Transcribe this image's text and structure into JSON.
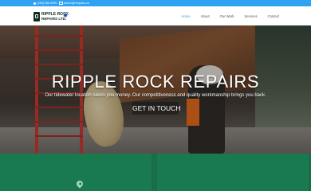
{
  "topbar": {
    "phone": "(250) 286-9999",
    "email": "admin@rrrepairs.ca"
  },
  "logo": {
    "line1": "RIPPLE ROCK",
    "line2": "REPAIRS LTD."
  },
  "nav": {
    "items": [
      {
        "label": "Home",
        "active": true
      },
      {
        "label": "About",
        "active": false
      },
      {
        "label": "Our Work",
        "active": false
      },
      {
        "label": "Services",
        "active": false
      },
      {
        "label": "Contact",
        "active": false
      }
    ]
  },
  "hero": {
    "title": "RIPPLE ROCK REPAIRS",
    "subtitle": "Our tidewater location saves you money. Our competitiveness and quality workmanship brings you back.",
    "cta_label": "GET IN TOUCH"
  },
  "features": {
    "left_icon": "map-pin-icon",
    "right_icon": "tools-icon"
  },
  "colors": {
    "accent": "#2ea3f2",
    "brand_green": "#1a7a4f",
    "logo_dark": "#0f2c1c"
  }
}
